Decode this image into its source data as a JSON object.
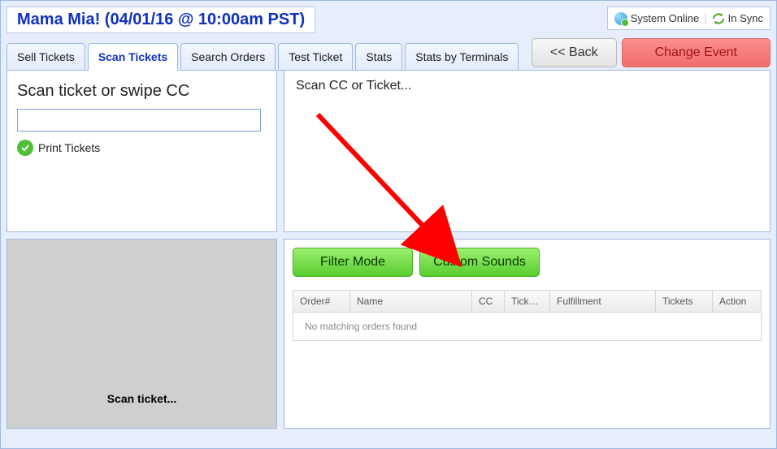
{
  "header": {
    "event_title": "Mama Mia! (04/01/16 @ 10:00am PST)",
    "status_online": "System Online",
    "status_sync": "In Sync"
  },
  "tabs": [
    {
      "label": "Sell Tickets"
    },
    {
      "label": "Scan Tickets",
      "active": true
    },
    {
      "label": "Search Orders"
    },
    {
      "label": "Test Ticket"
    },
    {
      "label": "Stats"
    },
    {
      "label": "Stats by Terminals"
    }
  ],
  "top_buttons": {
    "back": "<< Back",
    "change_event": "Change Event"
  },
  "scan_panel": {
    "heading": "Scan ticket or swipe CC",
    "input_value": "",
    "print_label": "Print Tickets"
  },
  "scan_message": "Scan CC or Ticket...",
  "gray_panel_text": "Scan ticket...",
  "orders_panel": {
    "filter_btn": "Filter Mode",
    "sounds_btn": "Custom Sounds",
    "columns": {
      "order": "Order#",
      "name": "Name",
      "cc": "CC",
      "ticket_type": "Ticket...",
      "fulfillment": "Fulfillment",
      "tickets": "Tickets",
      "action": "Action"
    },
    "empty_text": "No matching orders found"
  }
}
